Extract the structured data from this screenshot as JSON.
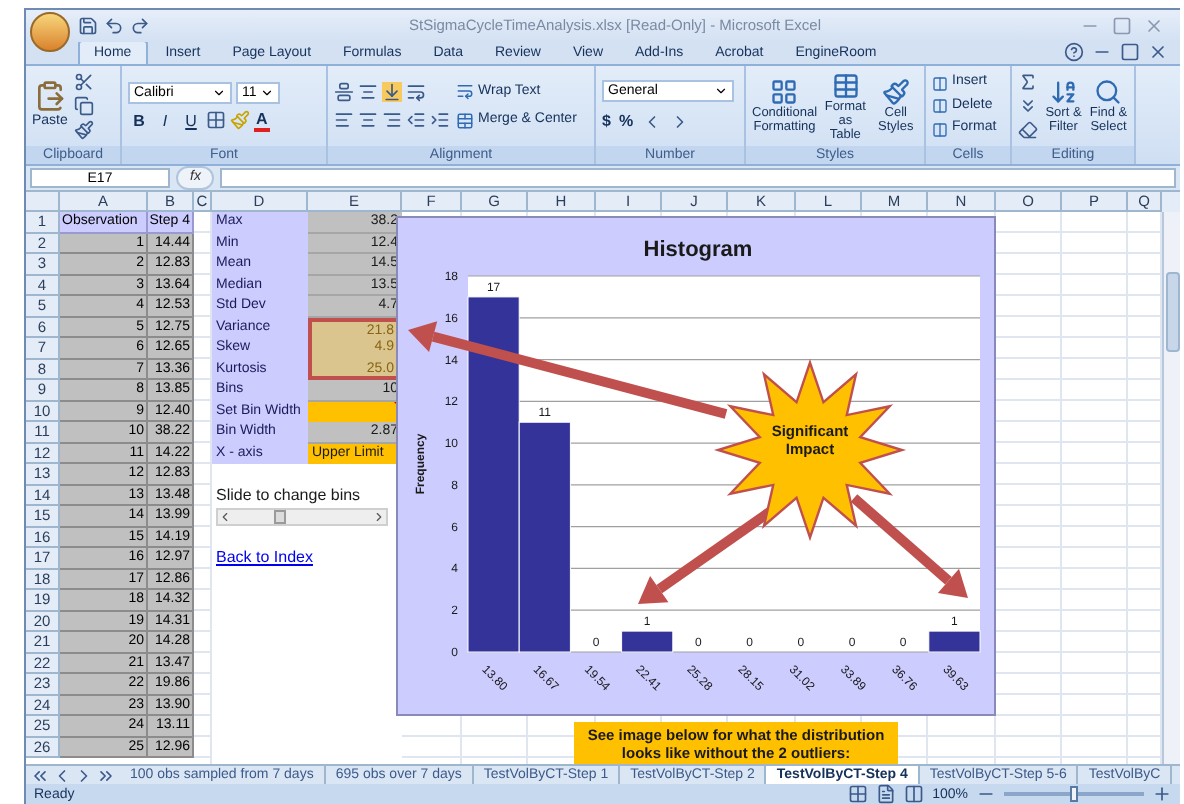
{
  "window": {
    "title": "StSigmaCycleTimeAnalysis.xlsx  [Read-Only] - Microsoft Excel"
  },
  "ribbon_tabs": [
    {
      "label": "Home",
      "selected": true
    },
    {
      "label": "Insert",
      "selected": false
    },
    {
      "label": "Page Layout",
      "selected": false
    },
    {
      "label": "Formulas",
      "selected": false
    },
    {
      "label": "Data",
      "selected": false
    },
    {
      "label": "Review",
      "selected": false
    },
    {
      "label": "View",
      "selected": false
    },
    {
      "label": "Add-Ins",
      "selected": false
    },
    {
      "label": "Acrobat",
      "selected": false
    },
    {
      "label": "EngineRoom",
      "selected": false
    }
  ],
  "ribbon": {
    "clipboard": {
      "label": "Clipboard",
      "paste": "Paste"
    },
    "font": {
      "label": "Font",
      "font_name": "Calibri",
      "font_size": "11",
      "style_buttons": [
        "B",
        "I",
        "U"
      ],
      "color_button": "A"
    },
    "alignment": {
      "label": "Alignment",
      "wrap_text": "Wrap Text",
      "merge_center": "Merge & Center"
    },
    "number": {
      "label": "Number",
      "format": "General",
      "currency": "$",
      "percent": "%"
    },
    "styles": {
      "label": "Styles",
      "buttons": [
        "Conditional Formatting",
        "Format as Table",
        "Cell Styles"
      ]
    },
    "cells": {
      "label": "Cells",
      "buttons": [
        "Insert",
        "Delete",
        "Format"
      ]
    },
    "editing": {
      "label": "Editing",
      "buttons": [
        "Sort & Filter",
        "Find & Select"
      ]
    }
  },
  "formula_bar": {
    "name_box": "E17",
    "fx": "fx"
  },
  "columns": [
    "A",
    "B",
    "C",
    "D",
    "E",
    "F",
    "G",
    "H",
    "I",
    "J",
    "K",
    "L",
    "M",
    "N",
    "O",
    "P",
    "Q"
  ],
  "table_header": {
    "row": "1",
    "observation": "Observation",
    "step": "Step 4"
  },
  "rows": [
    {
      "row": "2",
      "observation": "1",
      "step": "14.44"
    },
    {
      "row": "3",
      "observation": "2",
      "step": "12.83"
    },
    {
      "row": "4",
      "observation": "3",
      "step": "13.64"
    },
    {
      "row": "5",
      "observation": "4",
      "step": "12.53"
    },
    {
      "row": "6",
      "observation": "5",
      "step": "12.75"
    },
    {
      "row": "7",
      "observation": "6",
      "step": "12.65"
    },
    {
      "row": "8",
      "observation": "7",
      "step": "13.36"
    },
    {
      "row": "9",
      "observation": "8",
      "step": "13.85"
    },
    {
      "row": "10",
      "observation": "9",
      "step": "12.40"
    },
    {
      "row": "11",
      "observation": "10",
      "step": "38.22"
    },
    {
      "row": "12",
      "observation": "11",
      "step": "14.22"
    },
    {
      "row": "13",
      "observation": "12",
      "step": "12.83"
    },
    {
      "row": "14",
      "observation": "13",
      "step": "13.48"
    },
    {
      "row": "15",
      "observation": "14",
      "step": "13.99"
    },
    {
      "row": "16",
      "observation": "15",
      "step": "14.19"
    },
    {
      "row": "17",
      "observation": "16",
      "step": "12.97"
    },
    {
      "row": "18",
      "observation": "17",
      "step": "12.86"
    },
    {
      "row": "19",
      "observation": "18",
      "step": "14.32"
    },
    {
      "row": "20",
      "observation": "19",
      "step": "14.31"
    },
    {
      "row": "21",
      "observation": "20",
      "step": "14.28"
    },
    {
      "row": "22",
      "observation": "21",
      "step": "13.47"
    },
    {
      "row": "23",
      "observation": "22",
      "step": "19.86"
    },
    {
      "row": "24",
      "observation": "23",
      "step": "13.90"
    },
    {
      "row": "25",
      "observation": "24",
      "step": "13.11"
    },
    {
      "row": "26",
      "observation": "25",
      "step": "12.96"
    }
  ],
  "stats": [
    {
      "label": "Max",
      "value": "38.2",
      "kind": "plain"
    },
    {
      "label": "Min",
      "value": "12.4",
      "kind": "plain"
    },
    {
      "label": "Mean",
      "value": "14.5",
      "kind": "plain"
    },
    {
      "label": "Median",
      "value": "13.5",
      "kind": "plain"
    },
    {
      "label": "Std Dev",
      "value": "4.7",
      "kind": "plain"
    },
    {
      "label": "Variance",
      "value": "21.8",
      "kind": "highlight"
    },
    {
      "label": "Skew",
      "value": "4.9",
      "kind": "highlight"
    },
    {
      "label": "Kurtosis",
      "value": "25.0",
      "kind": "highlight"
    },
    {
      "label": "Bins",
      "value": "10",
      "kind": "plain"
    },
    {
      "label": "Set Bin Width",
      "kind": "input",
      "has_comment": true
    },
    {
      "label": "Bin Width",
      "value": "2.87",
      "kind": "plain"
    },
    {
      "label": "X - axis",
      "value": "Upper Limit",
      "kind": "input"
    }
  ],
  "bin_slider": {
    "label": "Slide to change bins",
    "level": 0.32
  },
  "back_link": "Back to Index",
  "histogram": {
    "chart_data": {
      "type": "bar",
      "title": "Histogram",
      "ylabel": "Frequency",
      "categories": [
        "13.80",
        "16.67",
        "19.54",
        "22.41",
        "25.28",
        "28.15",
        "31.02",
        "33.89",
        "36.76",
        "39.63"
      ],
      "series": [
        {
          "color": "#333399",
          "values": [
            17,
            11,
            0,
            1,
            0,
            0,
            0,
            0,
            0,
            1
          ]
        }
      ],
      "ylim": [
        0,
        18
      ],
      "yticks": [
        0,
        2,
        4,
        6,
        8,
        10,
        12,
        14,
        16,
        18
      ],
      "grid": true,
      "data_labels": true
    }
  },
  "callout": {
    "text": "Significant Impact"
  },
  "note": {
    "text": "See image below for what the distribution looks like without the 2 outliers:"
  },
  "sheet_tabs": [
    {
      "label": "100 obs sampled from 7 days",
      "selected": false
    },
    {
      "label": "695 obs over 7 days",
      "selected": false
    },
    {
      "label": "TestVolByCT-Step 1",
      "selected": false
    },
    {
      "label": "TestVolByCT-Step 2",
      "selected": false
    },
    {
      "label": "TestVolByCT-Step 4",
      "selected": true
    },
    {
      "label": "TestVolByCT-Step 5-6",
      "selected": false
    },
    {
      "label": "TestVolByC",
      "selected": false
    }
  ],
  "status_bar": {
    "text": "Ready",
    "zoom": "100%",
    "zoom_slider": {
      "level": 0.5
    }
  }
}
